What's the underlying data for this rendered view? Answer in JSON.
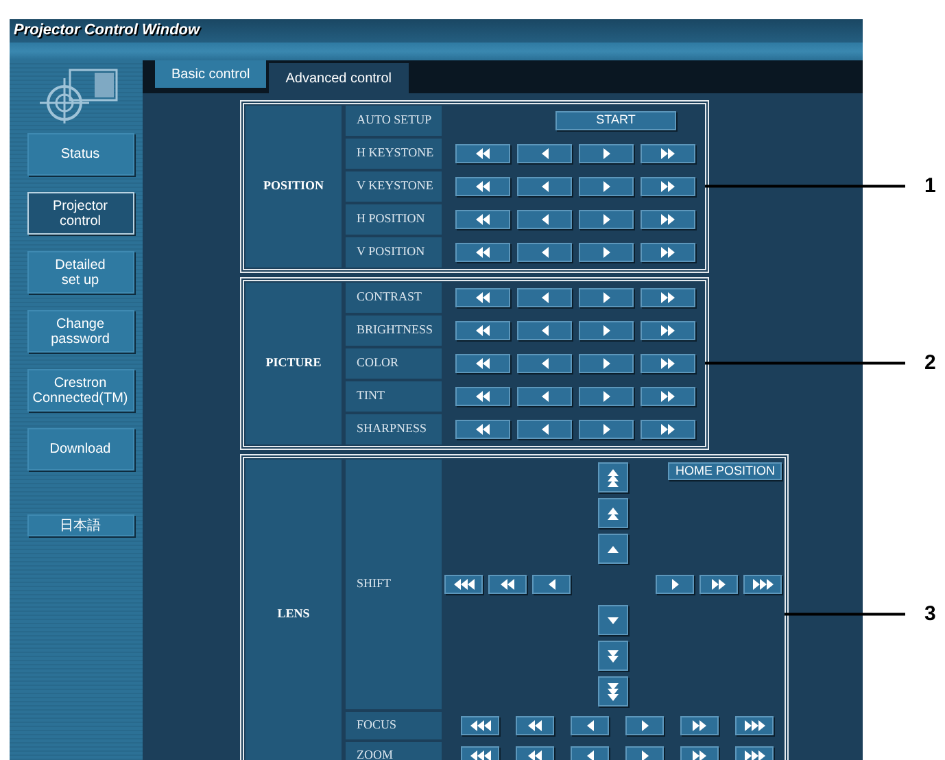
{
  "window": {
    "title": "Projector Control Window"
  },
  "sidebar": {
    "items": [
      {
        "label": "Status",
        "selected": false
      },
      {
        "label": "Projector\ncontrol",
        "selected": true
      },
      {
        "label": "Detailed\nset up",
        "selected": false
      },
      {
        "label": "Change\npassword",
        "selected": false
      },
      {
        "label": "Crestron\nConnected(TM)",
        "selected": false
      },
      {
        "label": "Download",
        "selected": false
      }
    ],
    "language_button": "日本語"
  },
  "tabs": [
    {
      "label": "Basic control",
      "selected": false
    },
    {
      "label": "Advanced control",
      "selected": true
    }
  ],
  "sections": [
    {
      "kind": "adjust",
      "label": "POSITION",
      "callout": "1",
      "rows": [
        {
          "kind": "start",
          "label": "AUTO SETUP",
          "button": "START"
        },
        {
          "kind": "arrows",
          "label": "H KEYSTONE"
        },
        {
          "kind": "arrows",
          "label": "V KEYSTONE"
        },
        {
          "kind": "arrows",
          "label": "H POSITION"
        },
        {
          "kind": "arrows",
          "label": "V POSITION"
        }
      ]
    },
    {
      "kind": "adjust",
      "label": "PICTURE",
      "callout": "2",
      "rows": [
        {
          "kind": "arrows",
          "label": "CONTRAST"
        },
        {
          "kind": "arrows",
          "label": "BRIGHTNESS"
        },
        {
          "kind": "arrows",
          "label": "COLOR"
        },
        {
          "kind": "arrows",
          "label": "TINT"
        },
        {
          "kind": "arrows",
          "label": "SHARPNESS"
        }
      ]
    },
    {
      "kind": "lens",
      "label": "LENS",
      "callout": "3",
      "rows": [
        {
          "kind": "shift",
          "label": "SHIFT",
          "button": "HOME POSITION"
        },
        {
          "kind": "arrows6",
          "label": "FOCUS"
        },
        {
          "kind": "arrows6",
          "label": "ZOOM"
        }
      ]
    }
  ]
}
